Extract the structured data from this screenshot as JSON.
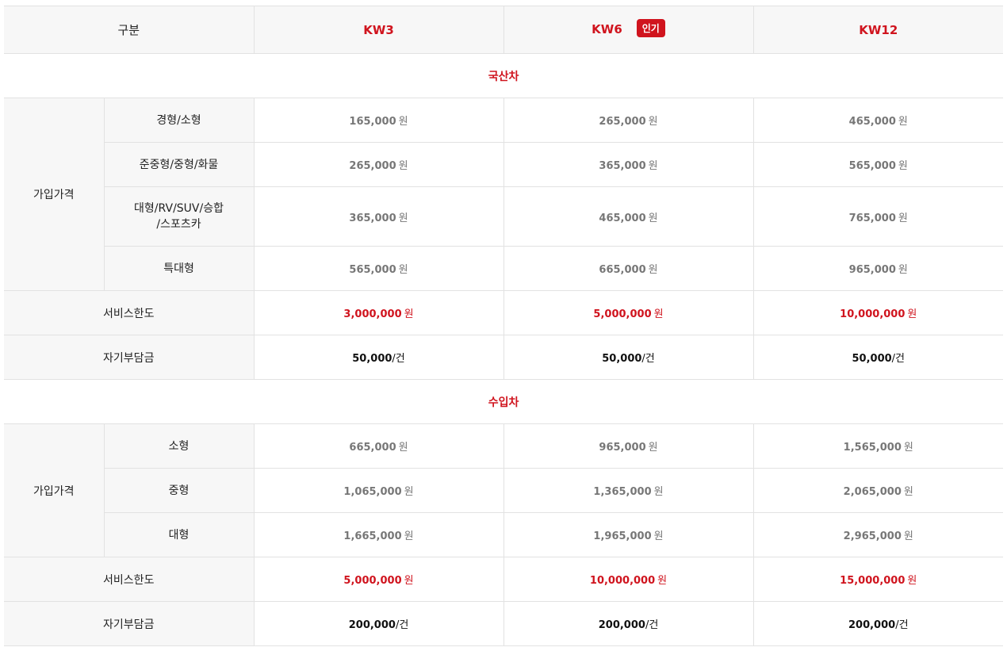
{
  "header": {
    "category_label": "구분",
    "plans": [
      {
        "name": "KW3",
        "badge": ""
      },
      {
        "name": "KW6",
        "badge": "인기"
      },
      {
        "name": "KW12",
        "badge": ""
      }
    ]
  },
  "sections": [
    {
      "title": "국산차",
      "price_group_label": "가입가격",
      "rows": [
        {
          "label": "경형/소형",
          "values": [
            "165,000",
            "265,000",
            "465,000"
          ],
          "unit": "원"
        },
        {
          "label": "준중형/중형/화물",
          "values": [
            "265,000",
            "365,000",
            "565,000"
          ],
          "unit": "원"
        },
        {
          "label": "대형/RV/SUV/승합",
          "label2": "/스포츠카",
          "values": [
            "365,000",
            "465,000",
            "765,000"
          ],
          "unit": "원"
        },
        {
          "label": "특대형",
          "values": [
            "565,000",
            "665,000",
            "965,000"
          ],
          "unit": "원"
        }
      ],
      "service_limit": {
        "label": "서비스한도",
        "values": [
          "3,000,000",
          "5,000,000",
          "10,000,000"
        ],
        "unit": "원"
      },
      "deductible": {
        "label": "자기부담금",
        "values": [
          "50,000",
          "50,000",
          "50,000"
        ],
        "unit": "/건"
      }
    },
    {
      "title": "수입차",
      "price_group_label": "가입가격",
      "rows": [
        {
          "label": "소형",
          "values": [
            "665,000",
            "965,000",
            "1,565,000"
          ],
          "unit": "원"
        },
        {
          "label": "중형",
          "values": [
            "1,065,000",
            "1,365,000",
            "2,065,000"
          ],
          "unit": "원"
        },
        {
          "label": "대형",
          "values": [
            "1,665,000",
            "1,965,000",
            "2,965,000"
          ],
          "unit": "원"
        }
      ],
      "service_limit": {
        "label": "서비스한도",
        "values": [
          "5,000,000",
          "10,000,000",
          "15,000,000"
        ],
        "unit": "원"
      },
      "deductible": {
        "label": "자기부담금",
        "values": [
          "200,000",
          "200,000",
          "200,000"
        ],
        "unit": "/건"
      }
    }
  ],
  "colors": {
    "accent": "#d0141e",
    "header_bg": "#f7f7f7",
    "border": "#e2e2e2",
    "price_text": "#777777"
  }
}
